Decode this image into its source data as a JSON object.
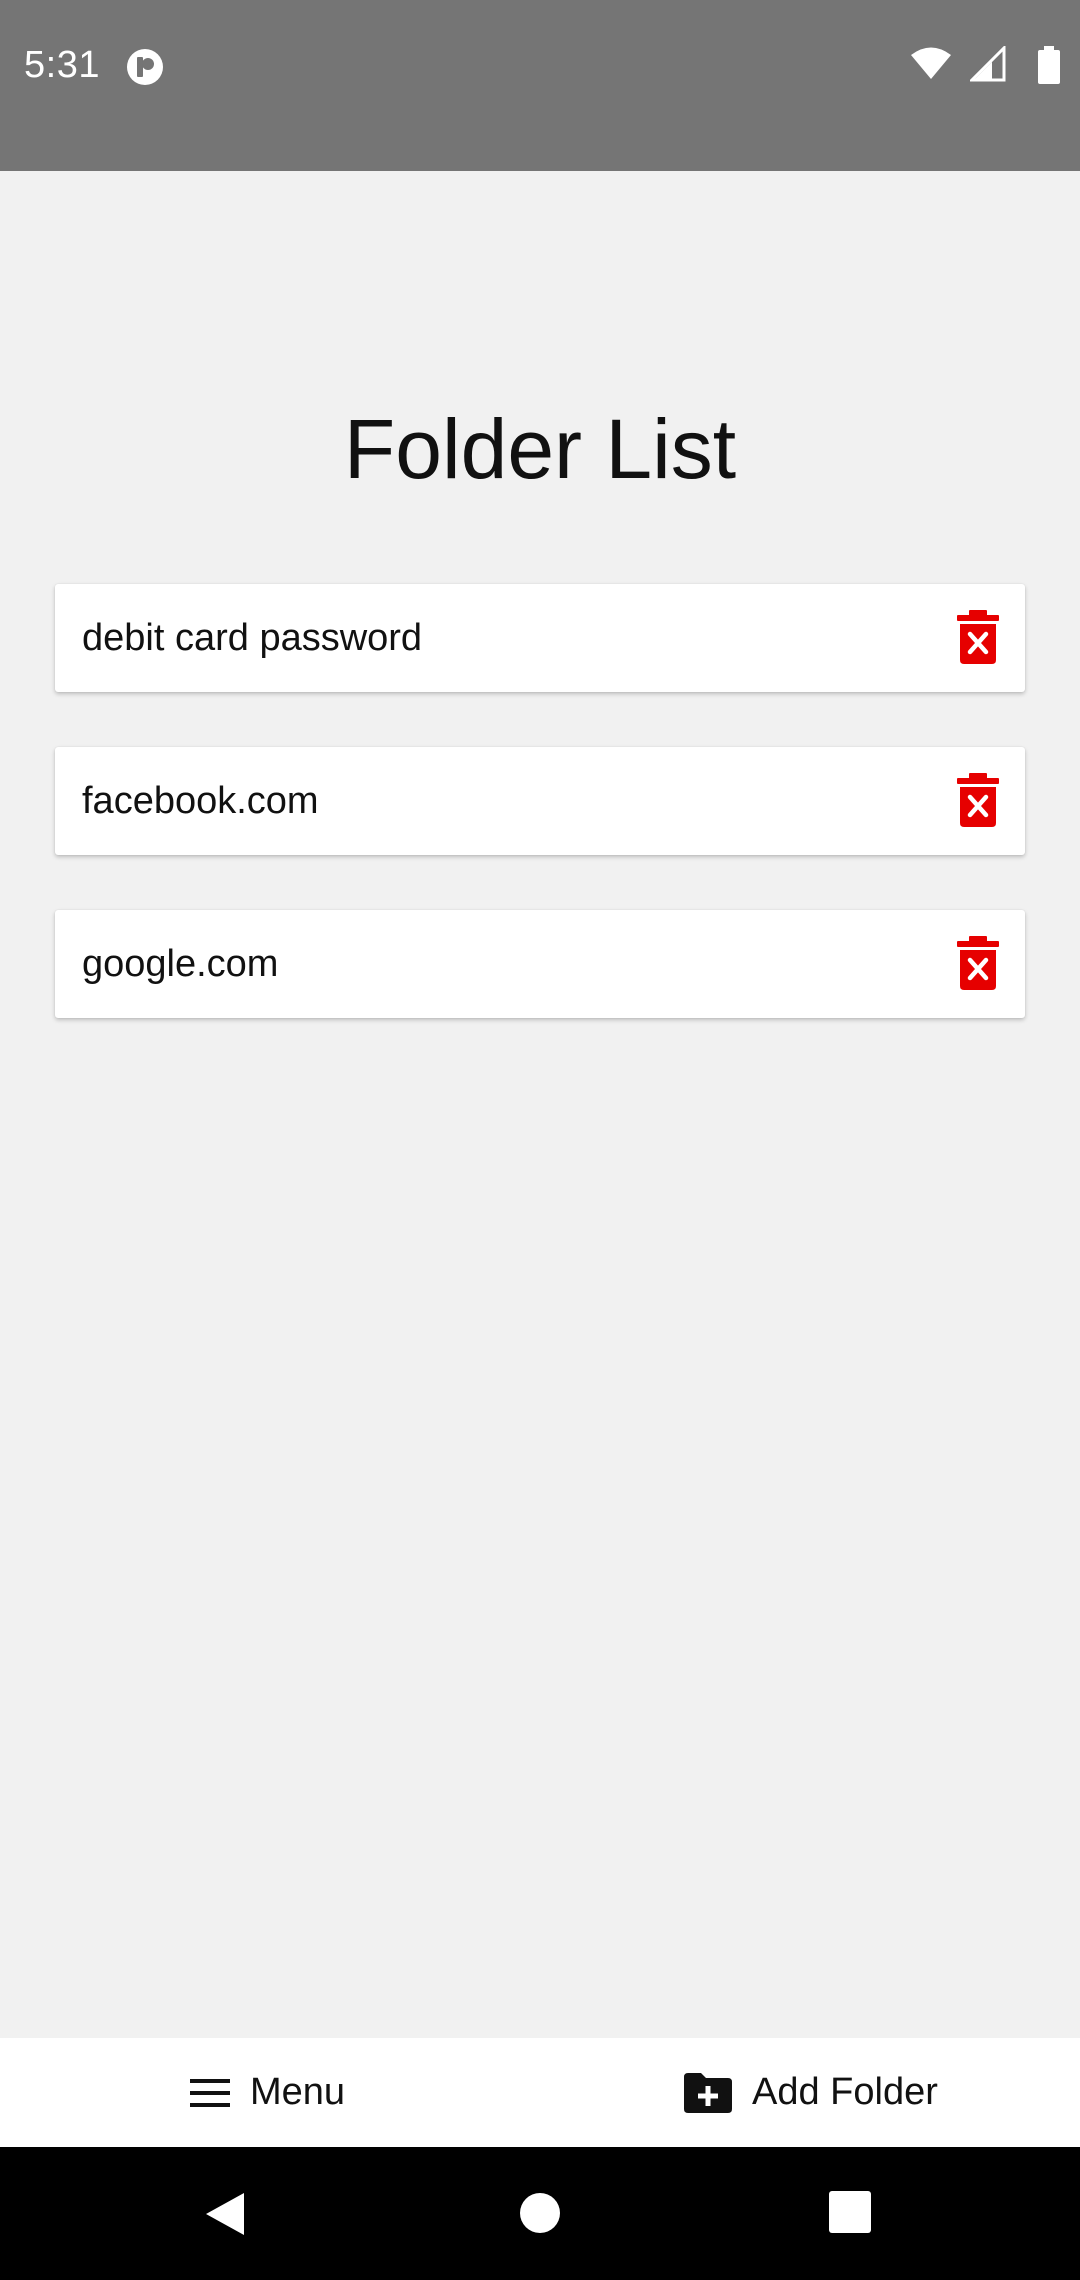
{
  "status_bar": {
    "time": "5:31",
    "background": "#757575"
  },
  "page": {
    "title": "Folder List",
    "background": "#f1f1f1"
  },
  "folders": [
    {
      "name": "debit card password",
      "delete_icon": "trash-x-icon"
    },
    {
      "name": "facebook.com",
      "delete_icon": "trash-x-icon"
    },
    {
      "name": "google.com",
      "delete_icon": "trash-x-icon"
    }
  ],
  "bottom_bar": {
    "menu_label": "Menu",
    "menu_icon": "hamburger-menu-icon",
    "add_folder_label": "Add Folder",
    "add_folder_icon": "folder-plus-icon"
  },
  "colors": {
    "delete": "#e60000",
    "text": "#111111"
  }
}
